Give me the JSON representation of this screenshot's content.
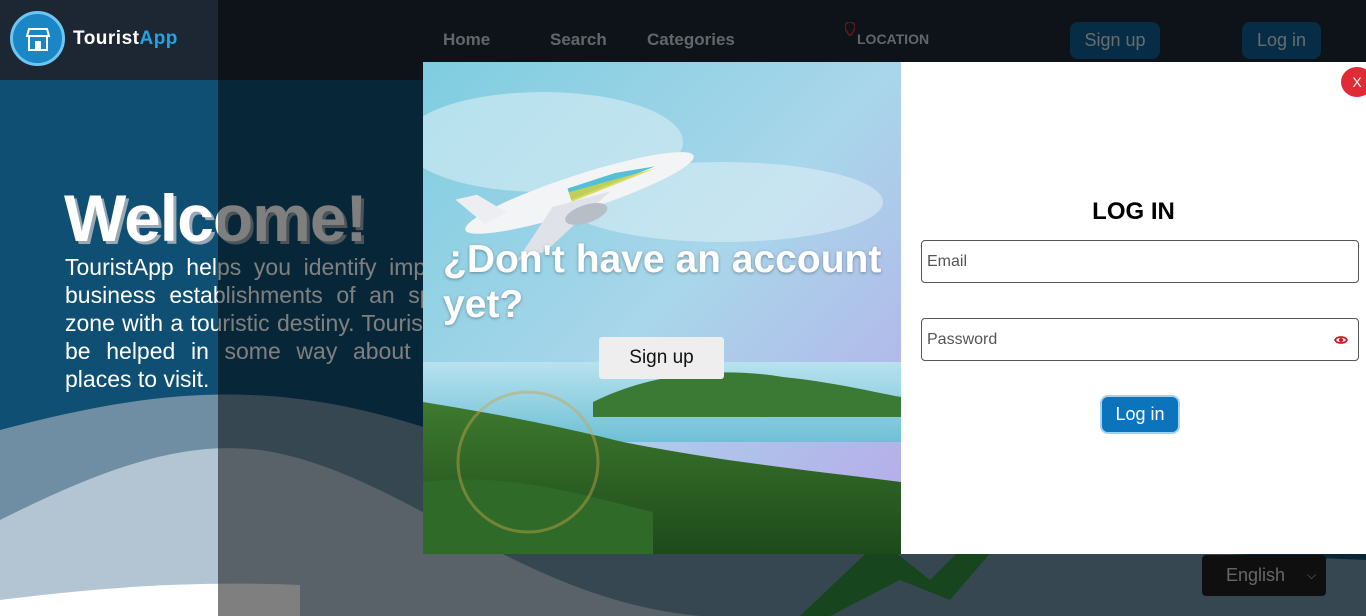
{
  "brand": {
    "name_part1": "Tourist",
    "name_part2": "App"
  },
  "nav": {
    "home": "Home",
    "search": "Search",
    "categories": "Categories",
    "location": "LOCATION",
    "signup": "Sign up",
    "login": "Log in"
  },
  "hero": {
    "title": "Welcome!",
    "text": "TouristApp helps you identify important business establishments of an specific zone with a touristic destiny. Tourists can be helped in some way about which places to visit."
  },
  "language": {
    "selected": "English"
  },
  "modal": {
    "promo_title": "¿Don't have an account yet?",
    "promo_button": "Sign up",
    "close": "X",
    "login_title": "LOG IN",
    "email_placeholder": "Email",
    "password_placeholder": "Password",
    "login_button": "Log in"
  },
  "icons": {
    "logo": "store-icon",
    "location": "map-pin-icon",
    "password_toggle": "eye-icon"
  },
  "colors": {
    "primary": "#0b74bd",
    "close": "#e02b36",
    "header": "#1d2733",
    "hero": "#0f4f73"
  }
}
